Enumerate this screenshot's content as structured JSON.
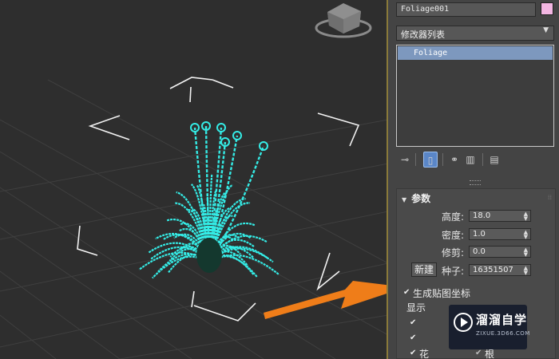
{
  "viewport": {
    "object_color": "#34ece6",
    "arrow_color": "#ef7d19"
  },
  "panel": {
    "object_name": "Foliage001",
    "object_color": "#f3b6e2",
    "modifier_list_label": "修改器列表",
    "stack": [
      {
        "label": "Foliage",
        "selected": true
      }
    ],
    "toolbar_icons": [
      "pin-stack-icon",
      "show-end-result-icon",
      "make-unique-icon",
      "remove-modifier-icon",
      "configure-modifier-sets-icon"
    ]
  },
  "params": {
    "title": "参数",
    "height_label": "高度:",
    "height_value": "18.0",
    "density_label": "密度:",
    "density_value": "1.0",
    "prune_label": "修剪:",
    "prune_value": "0.0",
    "new_label": "新建",
    "seed_label": "种子:",
    "seed_value": "16351507",
    "gen_map_coords_label": "生成贴图坐标",
    "gen_map_coords_checked": true,
    "show_label": "显示",
    "flowers_label": "花",
    "roots_label": "根"
  },
  "watermark": {
    "brand": "溜溜自学",
    "url": "ZIXUE.3D66.COM"
  }
}
